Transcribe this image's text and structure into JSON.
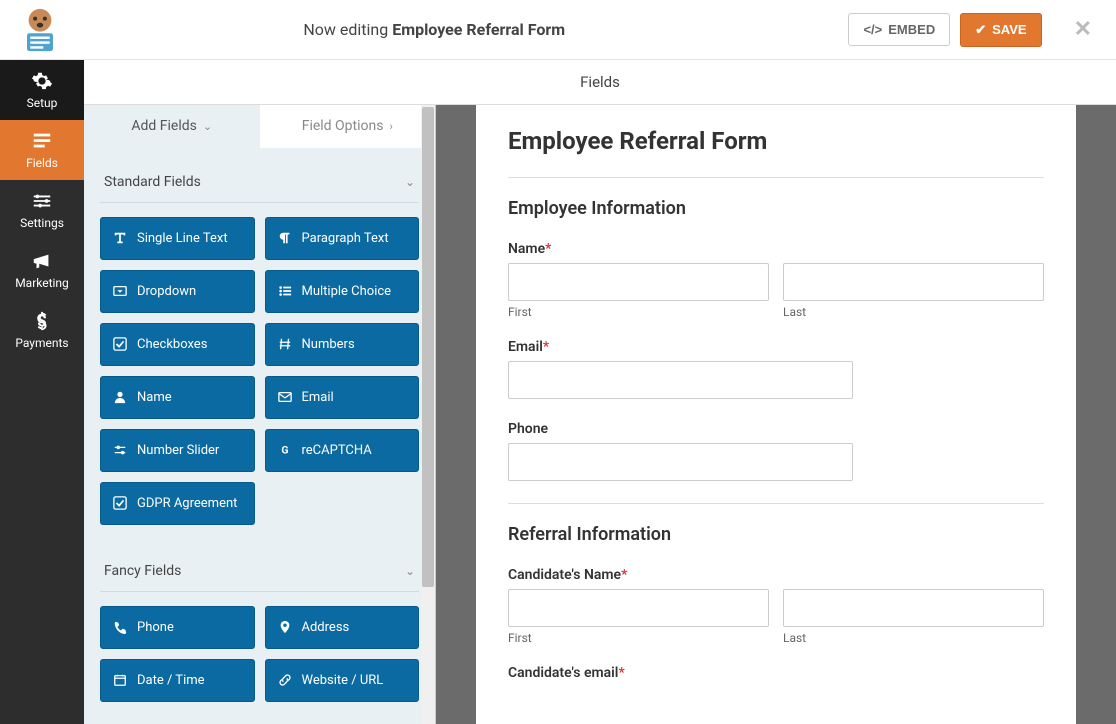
{
  "header": {
    "now_editing_prefix": "Now editing ",
    "form_name": "Employee Referral Form",
    "embed_label": "EMBED",
    "save_label": "SAVE"
  },
  "nav": {
    "setup": "Setup",
    "fields": "Fields",
    "settings": "Settings",
    "marketing": "Marketing",
    "payments": "Payments"
  },
  "panel_head": "Fields",
  "tabs": {
    "add_fields": "Add Fields",
    "field_options": "Field Options"
  },
  "groups": {
    "standard": "Standard Fields",
    "fancy": "Fancy Fields"
  },
  "standard_fields": {
    "single_line": "Single Line Text",
    "paragraph": "Paragraph Text",
    "dropdown": "Dropdown",
    "multiple_choice": "Multiple Choice",
    "checkboxes": "Checkboxes",
    "numbers": "Numbers",
    "name": "Name",
    "email": "Email",
    "number_slider": "Number Slider",
    "recaptcha": "reCAPTCHA",
    "gdpr": "GDPR Agreement"
  },
  "fancy_fields": {
    "phone": "Phone",
    "address": "Address",
    "datetime": "Date / Time",
    "website": "Website / URL"
  },
  "form": {
    "title": "Employee Referral Form",
    "section1": "Employee Information",
    "name_label": "Name",
    "first": "First",
    "last": "Last",
    "email_label": "Email",
    "phone_label": "Phone",
    "section2": "Referral Information",
    "cand_name": "Candidate's Name",
    "cand_email": "Candidate's email"
  }
}
